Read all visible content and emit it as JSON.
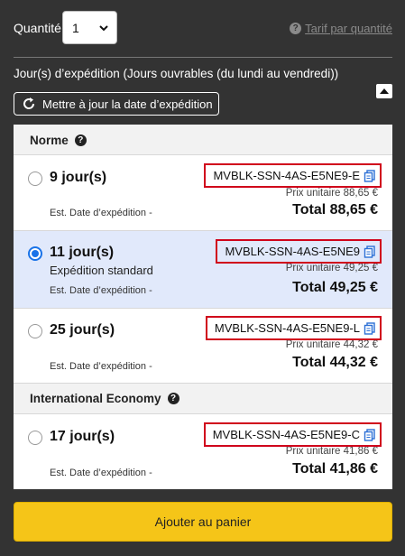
{
  "quantity": {
    "label": "Quantité",
    "selected": "1",
    "tier_link": "Tarif par quantité"
  },
  "shipping": {
    "title": "Jour(s) d’expédition (Jours ouvrables (du lundi au vendredi))",
    "update_button": "Mettre à jour la date d’expédition"
  },
  "groups": {
    "norme": {
      "title": "Norme"
    },
    "intl": {
      "title": "International Economy"
    }
  },
  "options": [
    {
      "days": "9 jour(s)",
      "standard": "",
      "est": "Est. Date d’expédition -",
      "sku": "MVBLK-SSN-4AS-E5NE9-E",
      "unit": "Prix unitaire 88,65 €",
      "total": "Total 88,65 €",
      "selected": false
    },
    {
      "days": "11 jour(s)",
      "standard": "Expédition standard",
      "est": "Est. Date d’expédition -",
      "sku": "MVBLK-SSN-4AS-E5NE9",
      "unit": "Prix unitaire 49,25 €",
      "total": "Total 49,25 €",
      "selected": true
    },
    {
      "days": "25 jour(s)",
      "standard": "",
      "est": "Est. Date d’expédition -",
      "sku": "MVBLK-SSN-4AS-E5NE9-L",
      "unit": "Prix unitaire 44,32 €",
      "total": "Total 44,32 €",
      "selected": false
    },
    {
      "days": "17 jour(s)",
      "standard": "",
      "est": "Est. Date d’expédition -",
      "sku": "MVBLK-SSN-4AS-E5NE9-C",
      "unit": "Prix unitaire 41,86 €",
      "total": "Total 41,86 €",
      "selected": false
    }
  ],
  "cart": {
    "label": "Ajouter au panier"
  },
  "icons": {
    "help": "question-circle-icon",
    "refresh": "refresh-icon",
    "collapse": "caret-up-icon",
    "copy": "copy-icon",
    "chevron": "chevron-down-icon"
  },
  "colors": {
    "background": "#333333",
    "selected_row": "#e1e9fb",
    "radio_accent": "#1a73e8",
    "sku_highlight": "#d0021b",
    "cart_button": "#f5c518"
  }
}
